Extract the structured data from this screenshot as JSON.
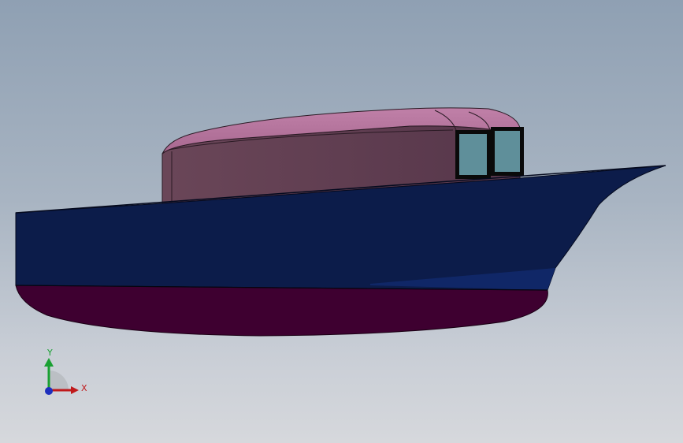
{
  "viewport": {
    "background_top": "#8fa0b3",
    "background_bottom": "#d6d8dc"
  },
  "model": {
    "hull_color": "#0c1c4a",
    "hull_shade_color": "#0f2563",
    "bottom_color": "#3e0030",
    "cabin_side_color": "#5c3a4c",
    "cabin_roof_color": "#b07096",
    "window_glass_color": "#5f8f9a",
    "window_frame_color": "#0a0a0a"
  },
  "triad": {
    "x_label": "X",
    "y_label": "Y",
    "x_color": "#c0191b",
    "y_color": "#19a032",
    "z_color": "#1e2fbd",
    "icon": "axis-triad-icon"
  }
}
